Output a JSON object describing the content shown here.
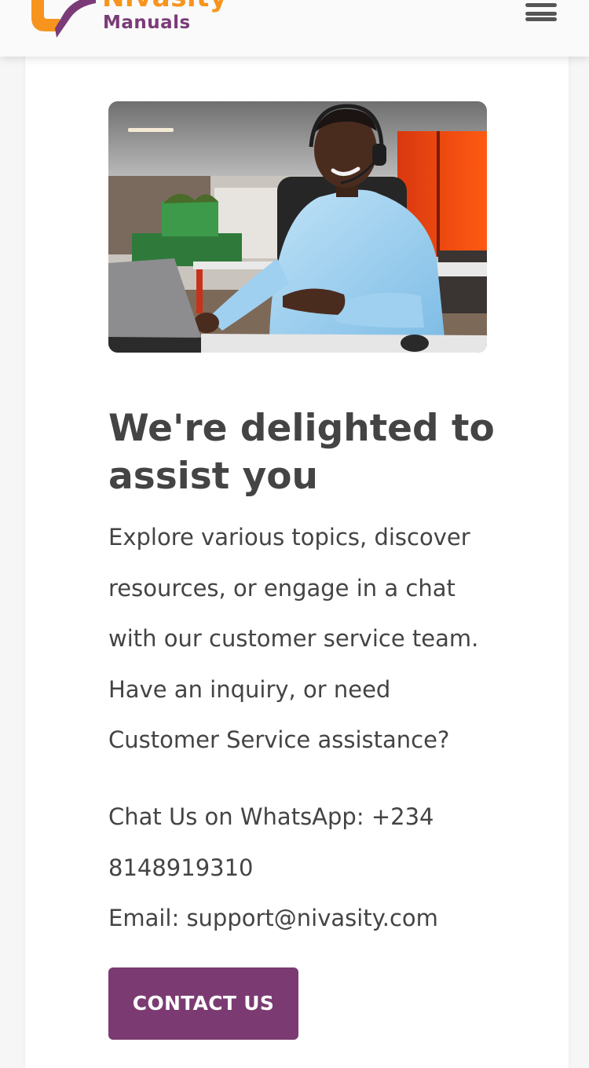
{
  "header": {
    "logo_title": "Nivasity",
    "logo_subtitle": "Manuals",
    "menu_icon": "hamburger-menu-icon"
  },
  "hero": {
    "image": "customer-service-agent-photo"
  },
  "content": {
    "headline": "We're delighted to assist you",
    "intro": "Explore various topics, discover resources, or engage in a chat with our customer service team. Have an inquiry, or need Customer Service assistance?",
    "whatsapp": "Chat Us on WhatsApp: +234 8148919310",
    "email": "Email: support@nivasity.com",
    "contact_button": "CONTACT US"
  },
  "colors": {
    "brand_orange": "#f7941d",
    "brand_purple": "#7b3b72",
    "text": "#444444"
  }
}
